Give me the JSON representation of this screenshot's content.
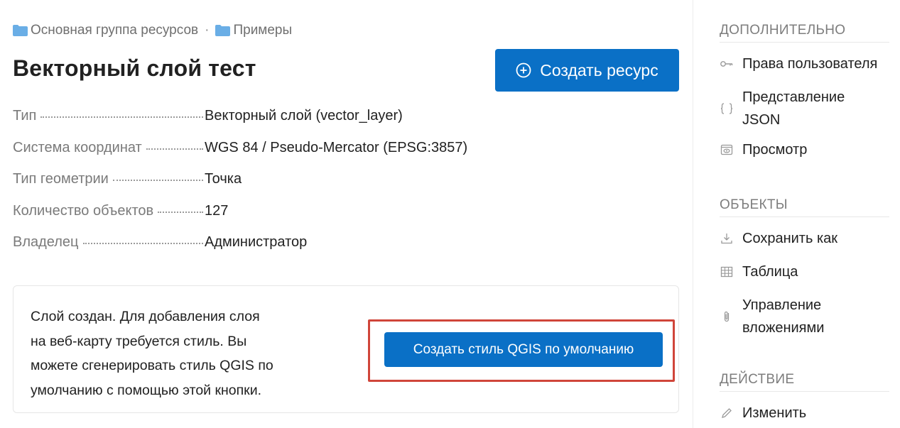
{
  "breadcrumb": {
    "items": [
      {
        "label": "Основная группа ресурсов",
        "icon": "folder-icon"
      },
      {
        "label": "Примеры",
        "icon": "folder-icon"
      }
    ],
    "separator": "·"
  },
  "page_title": "Векторный слой тест",
  "create_button": {
    "label": "Создать ресурс",
    "icon": "plus-circle-icon"
  },
  "properties": [
    {
      "key": "Тип",
      "value": "Векторный слой (vector_layer)"
    },
    {
      "key": "Система координат",
      "value": "WGS 84 / Pseudo-Mercator (EPSG:3857)"
    },
    {
      "key": "Тип геометрии",
      "value": "Точка"
    },
    {
      "key": "Количество объектов",
      "value": "127"
    },
    {
      "key": "Владелец",
      "value": "Администратор"
    }
  ],
  "notice": {
    "lines": [
      "Слой создан. Для добавления слоя",
      "на веб-карту требуется стиль. Вы",
      "можете сгенерировать стиль QGIS по",
      "умолчанию с помощью этой кнопки."
    ],
    "button_label": "Создать стиль QGIS по умолчанию",
    "highlight_color": "#d0453a"
  },
  "sidebar": {
    "additional": {
      "title": "ДОПОЛНИТЕЛЬНО",
      "items": [
        {
          "label": "Права пользователя",
          "icon": "key-icon"
        },
        {
          "label_line1": "Представление",
          "label_line2": "JSON",
          "icon": "braces-icon"
        },
        {
          "label": "Просмотр",
          "icon": "preview-icon"
        }
      ]
    },
    "objects": {
      "title": "ОБЪЕКТЫ",
      "items": [
        {
          "label": "Сохранить как",
          "icon": "download-icon"
        },
        {
          "label": "Таблица",
          "icon": "table-icon"
        },
        {
          "label_line1": "Управление",
          "label_line2": "вложениями",
          "icon": "paperclip-icon"
        }
      ]
    },
    "action": {
      "title": "ДЕЙСТВИЕ",
      "items": [
        {
          "label": "Изменить",
          "icon": "pencil-icon"
        }
      ]
    }
  },
  "colors": {
    "primary": "#0a70c6",
    "folder": "#6aaee6",
    "muted_text": "#7a7a7a"
  }
}
